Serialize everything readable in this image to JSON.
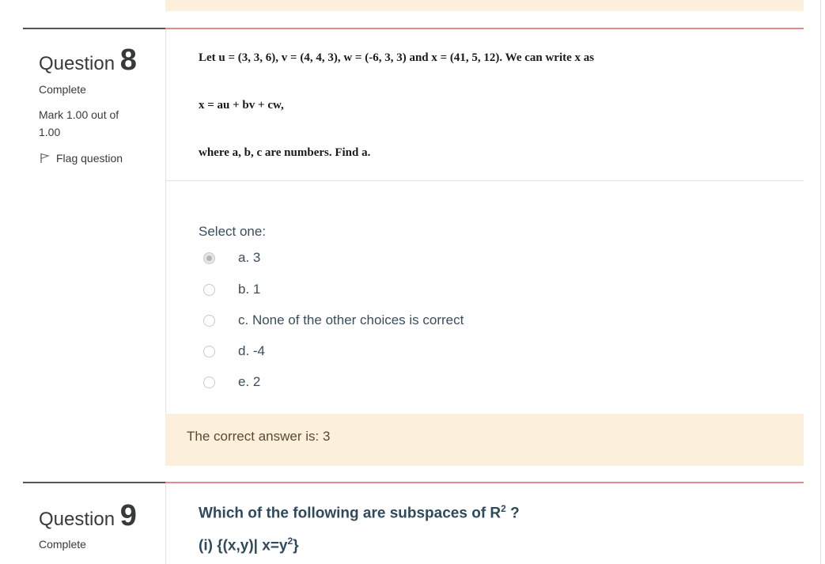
{
  "question8": {
    "label": "Question",
    "number": "8",
    "state": "Complete",
    "grade": "Mark 1.00 out of 1.00",
    "flag_label": "Flag question",
    "text_line1": "Let u = (3, 3, 6), v = (4, 4, 3), w = (-6, 3, 3) and x = (41, 5, 12). We can write x as",
    "text_line2": "x = au + bv + cw,",
    "text_line3": "where a, b, c are numbers. Find a.",
    "prompt": "Select one:",
    "answers": [
      {
        "label": "a. 3",
        "selected": true
      },
      {
        "label": "b. 1",
        "selected": false
      },
      {
        "label": "c. None of the other choices is correct",
        "selected": false
      },
      {
        "label": "d. -4",
        "selected": false
      },
      {
        "label": "e. 2",
        "selected": false
      }
    ],
    "feedback": "The correct answer is: 3"
  },
  "question9": {
    "label": "Question",
    "number": "9",
    "state": "Complete",
    "text_line1_pre": "Which of the following are subspaces of R",
    "text_line1_sup": "2",
    "text_line1_post": " ?",
    "text_line2_pre": "(i) {(x,y)| x=y",
    "text_line2_sup": "2",
    "text_line2_post": "}"
  },
  "colors": {
    "feedback_bg": "#fcefdc",
    "accent_rule": "#e8888f",
    "info_rule": "#555555"
  },
  "icons": {
    "flag": "flag-icon",
    "radio": "radio-icon"
  }
}
